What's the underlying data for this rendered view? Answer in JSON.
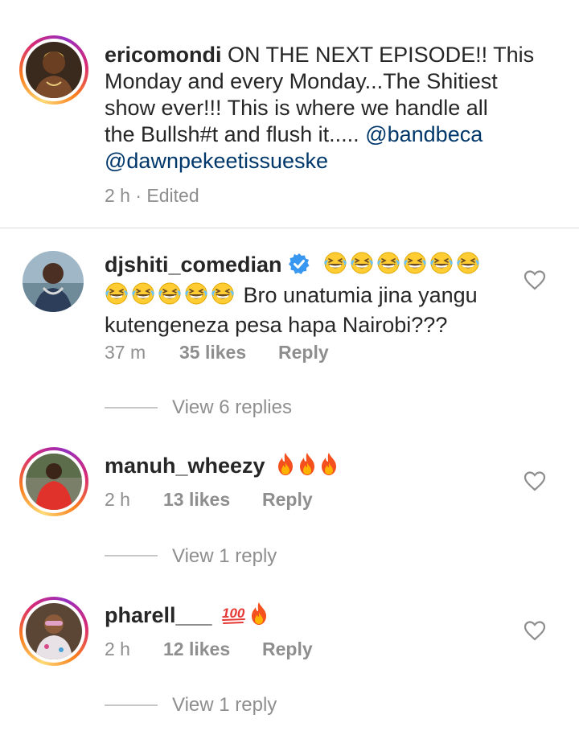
{
  "caption": {
    "username": "ericomondi",
    "text_line1": "ON THE NEXT EPISODE!! This",
    "text_line2": "Monday and every Monday...The Shitiest",
    "text_line3": "show ever!!! This is where we handle all",
    "text_line4": "the Bullsh#t and flush it.....",
    "mention1": "@bandbeca",
    "mention2": "@dawnpekeetissueske",
    "meta": "2 h · Edited"
  },
  "comments": [
    {
      "username": "djshiti_comedian",
      "verified": true,
      "text_line1": "Bro unatumia jina yangu",
      "text_line2": "kutengeneza pesa hapa Nairobi???",
      "emojis": [
        "grinning-squint-face",
        "grinning-squint-face",
        "grinning-squint-face",
        "grinning-squint-face",
        "grinning-squint-face",
        "grinning-squint-face",
        "grinning-squint-face",
        "grinning-squint-face",
        "grinning-squint-face",
        "grinning-squint-face",
        "grinning-squint-face"
      ],
      "time": "37 m",
      "likes": "35 likes",
      "reply": "Reply",
      "view_replies": "View 6 replies"
    },
    {
      "username": "manuh_wheezy",
      "emojis": [
        "fire",
        "fire",
        "fire"
      ],
      "time": "2 h",
      "likes": "13 likes",
      "reply": "Reply",
      "view_replies": "View 1 reply"
    },
    {
      "username": "pharell___",
      "emojis": [
        "hundred-points",
        "fire"
      ],
      "time": "2 h",
      "likes": "12 likes",
      "reply": "Reply",
      "view_replies": "View 1 reply"
    }
  ],
  "colors": {
    "text": "#262626",
    "secondary": "#8e8e8e",
    "mention": "#00376b",
    "verified": "#3897f0",
    "divider": "#dbdbdb"
  }
}
